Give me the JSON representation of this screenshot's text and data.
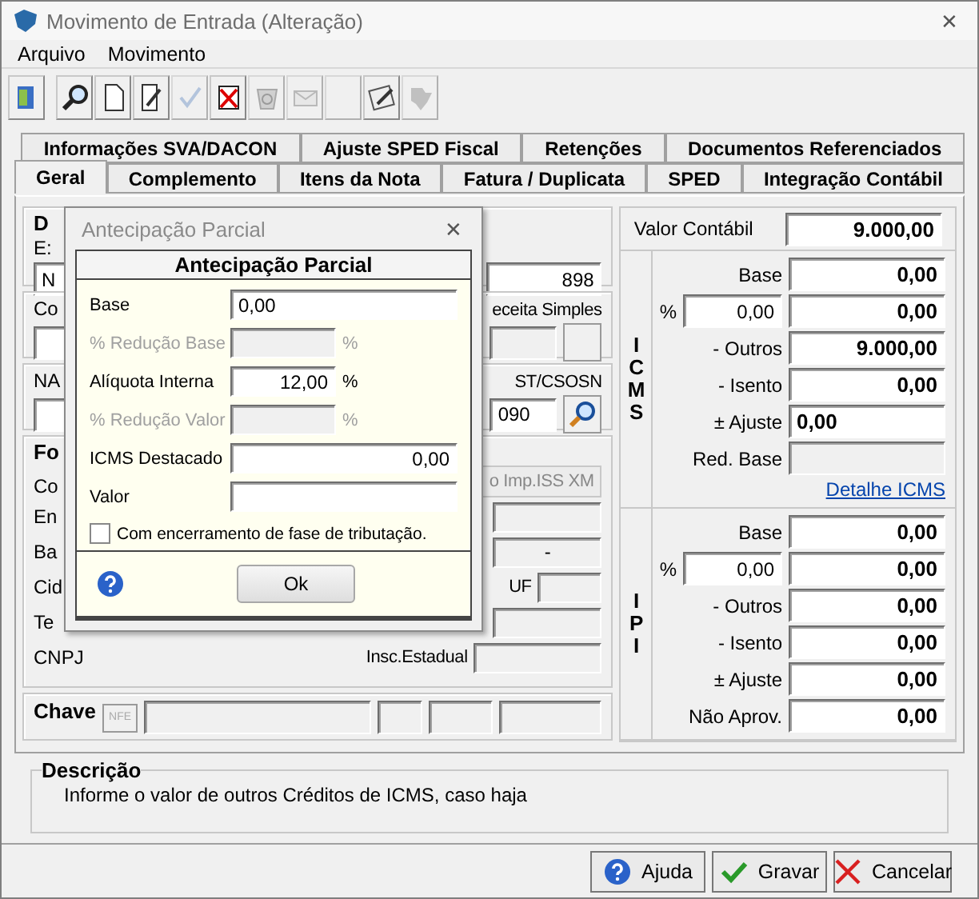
{
  "window": {
    "title": "Movimento de Entrada (Alteração)",
    "close": "✕"
  },
  "menu": [
    {
      "label": "Arquivo"
    },
    {
      "label": "Movimento"
    }
  ],
  "toolbar": [
    {
      "kind": "exit",
      "disabled": false
    },
    {
      "kind": "search",
      "disabled": false
    },
    {
      "kind": "new",
      "disabled": false
    },
    {
      "kind": "edit",
      "disabled": false
    },
    {
      "kind": "confirm",
      "disabled": true
    },
    {
      "kind": "delete",
      "disabled": false
    },
    {
      "kind": "refresh",
      "disabled": true
    },
    {
      "kind": "mail",
      "disabled": true
    },
    {
      "kind": "blank",
      "disabled": true
    },
    {
      "kind": "iss",
      "disabled": false
    },
    {
      "kind": "map",
      "disabled": true
    }
  ],
  "tab_rows": [
    {
      "tabs": [
        {
          "label": "Informações SVA/DACON",
          "selected": false
        },
        {
          "label": "Ajuste SPED Fiscal",
          "selected": false
        },
        {
          "label": "Retenções",
          "selected": false
        },
        {
          "label": "Documentos Referenciados",
          "selected": false
        }
      ]
    },
    {
      "tabs": [
        {
          "label": "Geral",
          "selected": true
        },
        {
          "label": "Complemento",
          "selected": false
        },
        {
          "label": "Itens da Nota",
          "selected": false
        },
        {
          "label": "Fatura / Duplicata",
          "selected": false
        },
        {
          "label": "SPED",
          "selected": false
        },
        {
          "label": "Integração Contábil",
          "selected": false
        }
      ]
    }
  ],
  "document": {
    "legend": "D",
    "label": "E:",
    "field_value": "N",
    "number": "898"
  },
  "row_1": {
    "label": "Co",
    "right_label": "eceita Simples"
  },
  "row_2": {
    "label": "NA",
    "right_label": "ST/CSOSN",
    "right_value": "090"
  },
  "supplier": {
    "legend": "Fo",
    "label": "Co",
    "right_text": "o Imp.ISS XM",
    "rows": [
      {
        "label": "En"
      },
      {
        "label": "Ba",
        "right_text": "-"
      },
      {
        "label": "Cid",
        "right_label": "UF"
      },
      {
        "label": "Te"
      },
      {
        "label": "CNPJ",
        "right_label": "Insc.Estadual"
      }
    ]
  },
  "chave": {
    "label": "Chave",
    "icon_text": "NFE"
  },
  "dialog": {
    "title": "Antecipação Parcial",
    "close": "✕",
    "header": "Antecipação Parcial",
    "fields": [
      {
        "kind": "text",
        "label": "Base",
        "value": "0,00",
        "disabled": false
      },
      {
        "kind": "number",
        "label": "% Redução Base",
        "suffix": "%",
        "disabled": true
      },
      {
        "kind": "number",
        "label": "Alíquota Interna",
        "value": "12,00",
        "suffix": "%",
        "disabled": false
      },
      {
        "kind": "number",
        "label": "% Redução Valor",
        "suffix": "%",
        "disabled": true
      },
      {
        "kind": "number",
        "label": "ICMS Destacado",
        "value": "0,00",
        "disabled": false
      },
      {
        "kind": "text",
        "label": "Valor",
        "disabled": false
      }
    ],
    "checkbox": {
      "label": "Com encerramento de fase de tributação.",
      "checked": false
    },
    "button": "Ok"
  },
  "totals": {
    "label": "Valor Contábil",
    "value": "9.000,00"
  },
  "icms": {
    "letters": [
      "I",
      "C",
      "M",
      "S"
    ],
    "rows": [
      {
        "kind": "value",
        "label": "Base",
        "value": "0,00"
      },
      {
        "kind": "percent",
        "label": "%",
        "percent": "0,00",
        "value": "0,00"
      },
      {
        "kind": "value",
        "label": "- Outros",
        "value": "9.000,00"
      },
      {
        "kind": "value",
        "label": "- Isento",
        "value": "0,00"
      },
      {
        "kind": "edit",
        "label": "± Ajuste",
        "value": "0,00"
      },
      {
        "kind": "disabled",
        "label": "Red. Base"
      }
    ],
    "link": "Detalhe ICMS"
  },
  "ipi": {
    "letters": [
      "I",
      "P",
      "I"
    ],
    "rows": [
      {
        "kind": "value",
        "label": "Base",
        "value": "0,00"
      },
      {
        "kind": "percent",
        "label": "%",
        "percent": "0,00",
        "value": "0,00"
      },
      {
        "kind": "value",
        "label": "- Outros",
        "value": "0,00"
      },
      {
        "kind": "value",
        "label": "- Isento",
        "value": "0,00"
      },
      {
        "kind": "value",
        "label": "± Ajuste",
        "value": "0,00"
      },
      {
        "kind": "value",
        "label": "Não Aprov.",
        "value": "0,00"
      }
    ]
  },
  "description": {
    "title": "Descrição",
    "text": "Informe o valor de outros Créditos de ICMS, caso haja"
  },
  "buttons": [
    {
      "kind": "help",
      "label": "Ajuda"
    },
    {
      "kind": "save",
      "label": "Gravar"
    },
    {
      "kind": "cancel",
      "label": "Cancelar"
    }
  ]
}
